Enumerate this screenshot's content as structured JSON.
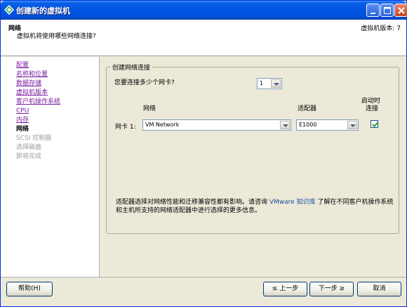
{
  "window": {
    "title": "创建新的虚拟机"
  },
  "header": {
    "title": "网络",
    "subtitle": "虚拟机将使用哪些网络连接?",
    "vm_version": "虚拟机版本: 7"
  },
  "nav": {
    "items": [
      {
        "label": "配置",
        "state": "link"
      },
      {
        "label": "名称和位置",
        "state": "link"
      },
      {
        "label": "数据存储",
        "state": "link"
      },
      {
        "label": "虚拟机版本",
        "state": "link"
      },
      {
        "label": "客户机操作系统",
        "state": "link"
      },
      {
        "label": "CPU",
        "state": "link"
      },
      {
        "label": "内存",
        "state": "link"
      },
      {
        "label": "网络",
        "state": "current"
      },
      {
        "label": "SCSI 控制器",
        "state": "disabled"
      },
      {
        "label": "选择磁盘",
        "state": "disabled"
      },
      {
        "label": "即将完成",
        "state": "disabled"
      }
    ]
  },
  "group": {
    "title": "创建网络连接",
    "nic_count_question": "您要连接多少个网卡?",
    "nic_count_value": "1",
    "col_network": "网络",
    "col_adapter": "适配器",
    "col_connect_line1": "启动时",
    "col_connect_line2": "连接",
    "row_label": "网卡 1:",
    "network_value": "VM Network",
    "adapter_value": "E1000",
    "connect_checked": true
  },
  "info": {
    "text_before": "适配器选择对网络性能和迁移兼容性都有影响。请咨询 ",
    "link": "VMware 知识库",
    "text_after": " 了解在不同客户机操作系统和主机所支持的网络适配器中进行选择的更多信息。"
  },
  "buttons": {
    "help": "帮助(H)",
    "back": "≤ 上一步",
    "next": "下一步 ≥",
    "cancel": "取消"
  }
}
